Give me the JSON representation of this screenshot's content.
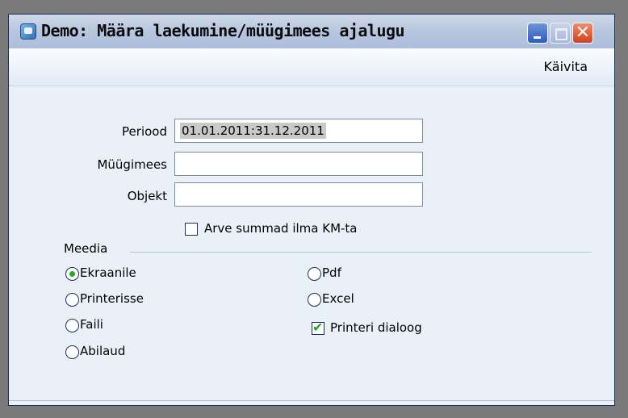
{
  "window": {
    "title": "Demo: Määra laekumine/müügimees ajalugu",
    "buttons": {
      "minimize": "minimize",
      "maximize": "maximize",
      "close": "close"
    }
  },
  "toolbar": {
    "run_label": "Käivita"
  },
  "form": {
    "period": {
      "label": "Periood",
      "value": "01.01.2011:31.12.2011"
    },
    "salesperson": {
      "label": "Müügimees",
      "value": ""
    },
    "object": {
      "label": "Objekt",
      "value": ""
    },
    "vat_checkbox": {
      "label": "Arve summad ilma KM-ta",
      "checked": false
    }
  },
  "media": {
    "label": "Meedia",
    "options_left": [
      {
        "label": "Ekraanile",
        "selected": true
      },
      {
        "label": "Printerisse",
        "selected": false
      },
      {
        "label": "Faili",
        "selected": false
      },
      {
        "label": "Abilaud",
        "selected": false
      }
    ],
    "options_right": [
      {
        "label": "Pdf",
        "selected": false
      },
      {
        "label": "Excel",
        "selected": false
      }
    ],
    "printer_dialog": {
      "label": "Printeri dialoog",
      "checked": true
    }
  },
  "colors": {
    "accent": "#2aa52a",
    "title_bar": "#b7c6df",
    "close_button": "#d3401c"
  }
}
